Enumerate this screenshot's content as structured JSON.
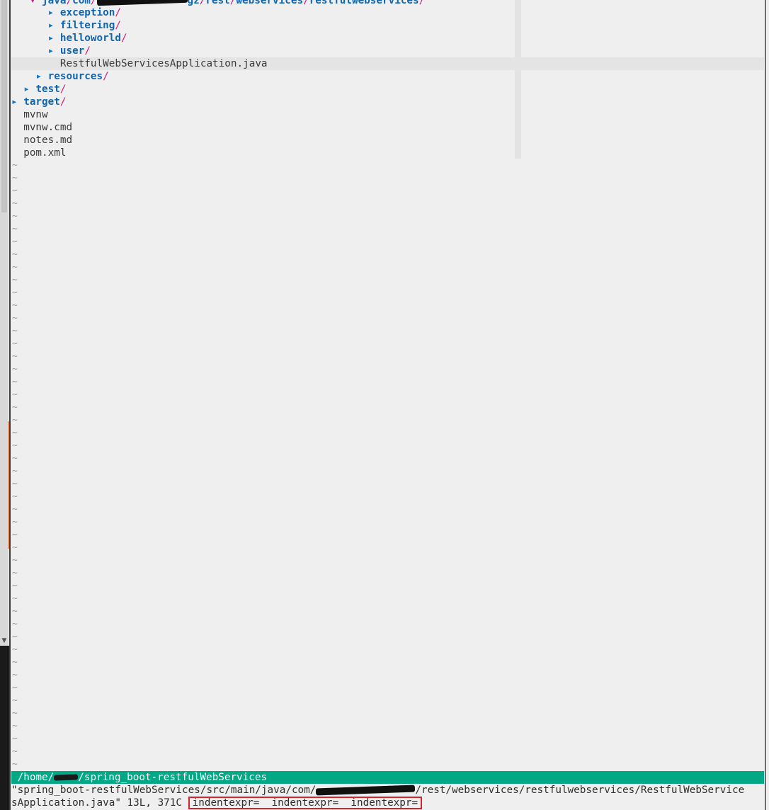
{
  "tree": {
    "java_path": {
      "arrow": "▾",
      "segment_java": "java",
      "segment_com": "com",
      "segment_gz": "gz",
      "segment_rest": "rest",
      "segment_webservices": "webservices",
      "segment_restfulwebservices": "restfulwebservices",
      "slash": "/"
    },
    "items": [
      {
        "kind": "dir",
        "arrow": "▸",
        "name": "exception",
        "suffix": "/"
      },
      {
        "kind": "dir",
        "arrow": "▸",
        "name": "filtering",
        "suffix": "/"
      },
      {
        "kind": "dir",
        "arrow": "▸",
        "name": "helloworld",
        "suffix": "/"
      },
      {
        "kind": "dir",
        "arrow": "▸",
        "name": "user",
        "suffix": "/"
      },
      {
        "kind": "file",
        "name": "RestfulWebServicesApplication.java"
      },
      {
        "kind": "dir",
        "arrow": "▸",
        "name": "resources",
        "suffix": "/"
      },
      {
        "kind": "dir",
        "arrow": "▸",
        "name": "test",
        "suffix": "/"
      },
      {
        "kind": "dir",
        "arrow": "▸",
        "name": "target",
        "suffix": "/"
      },
      {
        "kind": "file",
        "name": "mvnw"
      },
      {
        "kind": "file",
        "name": "mvnw.cmd"
      },
      {
        "kind": "file",
        "name": "notes.md"
      },
      {
        "kind": "file",
        "name": "pom.xml"
      }
    ]
  },
  "empty_line_marker": "~",
  "statusline": {
    "prefix": " /home/",
    "suffix": "/spring_boot-restfulWebServices"
  },
  "cmdline": {
    "line1_prefix": "\"spring_boot-restfulWebServices/src/main/java/com/",
    "line1_suffix": "/rest/webservices/restfulwebservices/RestfulWebService",
    "line2_prefix": "sApplication.java\" 13L, 371C",
    "highlight_text": "indentexpr=  indentexpr=  indentexpr="
  },
  "colors": {
    "directory": "#1066b0",
    "slash": "#cc1e79",
    "arrow": "#1077c6",
    "statusline_bg": "#00a885",
    "highlight_border": "#d9232a"
  },
  "icons": {
    "expanded": "triangle-down-icon",
    "collapsed": "triangle-right-icon",
    "scroll_down": "scroll-down-arrow-icon"
  }
}
